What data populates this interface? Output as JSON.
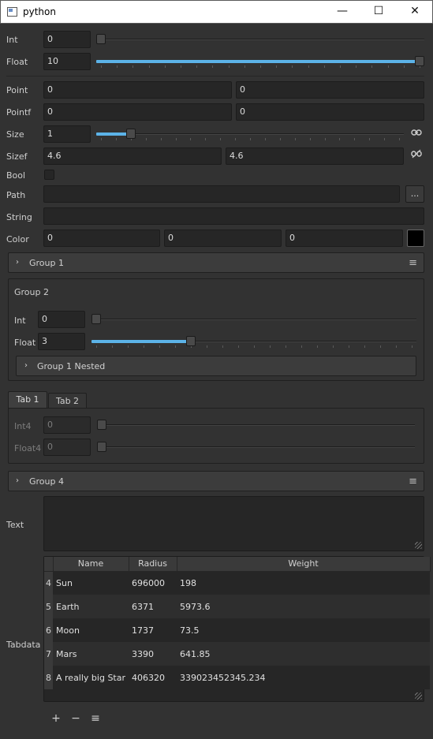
{
  "window": {
    "title": "python",
    "minimize": "—",
    "maximize": "☐",
    "close": "✕"
  },
  "fields": {
    "int": {
      "label": "Int",
      "value": "0",
      "slider_fraction": 0.0
    },
    "float": {
      "label": "Float",
      "value": "10",
      "slider_fraction": 1.0
    },
    "point": {
      "label": "Point",
      "x": "0",
      "y": "0"
    },
    "pointf": {
      "label": "Pointf",
      "x": "0",
      "y": "0"
    },
    "size": {
      "label": "Size",
      "value": "1",
      "slider_fraction": 0.1,
      "link_icon": "link-icon"
    },
    "sizef": {
      "label": "Sizef",
      "w": "4.6",
      "h": "4.6",
      "link_icon": "unlink-icon"
    },
    "bool": {
      "label": "Bool",
      "checked": false
    },
    "path": {
      "label": "Path",
      "value": "",
      "browse_label": "..."
    },
    "string": {
      "label": "String",
      "value": ""
    },
    "color": {
      "label": "Color",
      "r": "0",
      "g": "0",
      "b": "0",
      "swatch": "#000000"
    }
  },
  "group1": {
    "label": "Group 1",
    "chevron": "›",
    "menu": "≡"
  },
  "group2": {
    "label": "Group 2",
    "int": {
      "label": "Int",
      "value": "0",
      "slider_fraction": 0.0
    },
    "float": {
      "label": "Float",
      "value": "3",
      "slider_fraction": 0.3
    },
    "nested": {
      "label": "Group 1 Nested",
      "chevron": "›"
    }
  },
  "tabs": [
    {
      "label": "Tab 1",
      "active": true
    },
    {
      "label": "Tab 2",
      "active": false
    }
  ],
  "tab1": {
    "int4": {
      "label": "Int4",
      "value": "0"
    },
    "float4": {
      "label": "Float4",
      "value": "0"
    }
  },
  "group4": {
    "label": "Group 4",
    "chevron": "›",
    "menu": "≡"
  },
  "text": {
    "label": "Text",
    "value": ""
  },
  "tabdata": {
    "label": "Tabdata",
    "columns": [
      "Name",
      "Radius",
      "Weight"
    ],
    "rows": [
      {
        "index": "4",
        "name": "Sun",
        "radius": "696000",
        "weight": "198"
      },
      {
        "index": "5",
        "name": "Earth",
        "radius": "6371",
        "weight": "5973.6"
      },
      {
        "index": "6",
        "name": "Moon",
        "radius": "1737",
        "weight": "73.5"
      },
      {
        "index": "7",
        "name": "Mars",
        "radius": "3390",
        "weight": "641.85"
      },
      {
        "index": "8",
        "name": "A really big Star",
        "radius": "406320",
        "weight": "339023452345.234"
      }
    ],
    "add": "+",
    "remove": "−",
    "edit": "≡"
  },
  "colors": {
    "accent": "#5cb3e8",
    "background": "#323232",
    "field": "#262626"
  }
}
